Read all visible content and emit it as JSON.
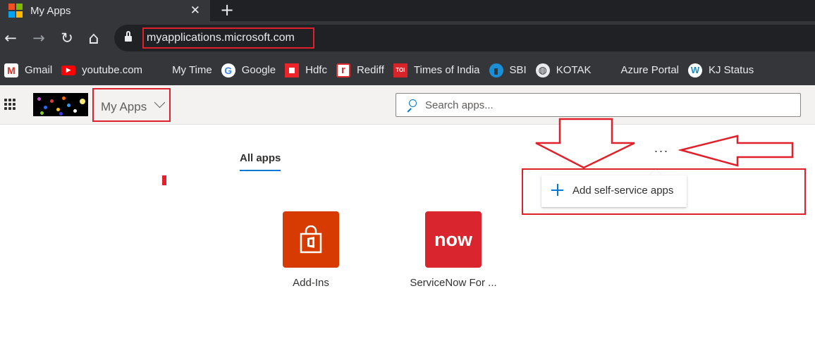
{
  "browser": {
    "tab_title": "My Apps",
    "tab_close": "✕",
    "new_tab": "+",
    "url": "myapplications.microsoft.com",
    "nav": {
      "back": "←",
      "forward": "→",
      "reload": "↻",
      "home": "⌂"
    },
    "bookmarks": [
      {
        "label": "Gmail",
        "icon": "gmail-icon",
        "color": "#d93025",
        "glyph": "M"
      },
      {
        "label": "youtube.com",
        "icon": "youtube-icon",
        "color": "#ff0000",
        "glyph": "▶"
      },
      {
        "label": "My Time",
        "icon": "microsoft-icon",
        "color": "",
        "glyph": ""
      },
      {
        "label": "Google",
        "icon": "google-icon",
        "color": "#ffffff",
        "glyph": "G"
      },
      {
        "label": "Hdfc",
        "icon": "hdfc-icon",
        "color": "#ed232a",
        "glyph": "◘"
      },
      {
        "label": "Rediff",
        "icon": "rediff-icon",
        "color": "#e12a2f",
        "glyph": "r"
      },
      {
        "label": "Times of India",
        "icon": "toi-icon",
        "color": "#d8232a",
        "glyph": "TOI"
      },
      {
        "label": "SBI",
        "icon": "sbi-icon",
        "color": "#1a8fd6",
        "glyph": "◉"
      },
      {
        "label": "KOTAK",
        "icon": "globe-icon",
        "color": "#5f6368",
        "glyph": "◍"
      },
      {
        "label": "Azure Portal",
        "icon": "microsoft-icon",
        "color": "",
        "glyph": ""
      },
      {
        "label": "KJ Status",
        "icon": "wordpress-icon",
        "color": "#1e8cbe",
        "glyph": "W"
      }
    ]
  },
  "header": {
    "app_name": "My Apps",
    "search_placeholder": "Search apps..."
  },
  "main": {
    "active_tab": "All apps",
    "more_label": "...",
    "menu_item": "Add self-service apps",
    "apps": [
      {
        "label": "Add-Ins",
        "color": "#d83b01",
        "icon": "office-bag-icon"
      },
      {
        "label": "ServiceNow For ...",
        "color": "#d9262e",
        "icon": "servicenow-icon",
        "glyph": "now"
      }
    ]
  },
  "colors": {
    "accent": "#0078d4",
    "annotation": "#e0202a"
  }
}
